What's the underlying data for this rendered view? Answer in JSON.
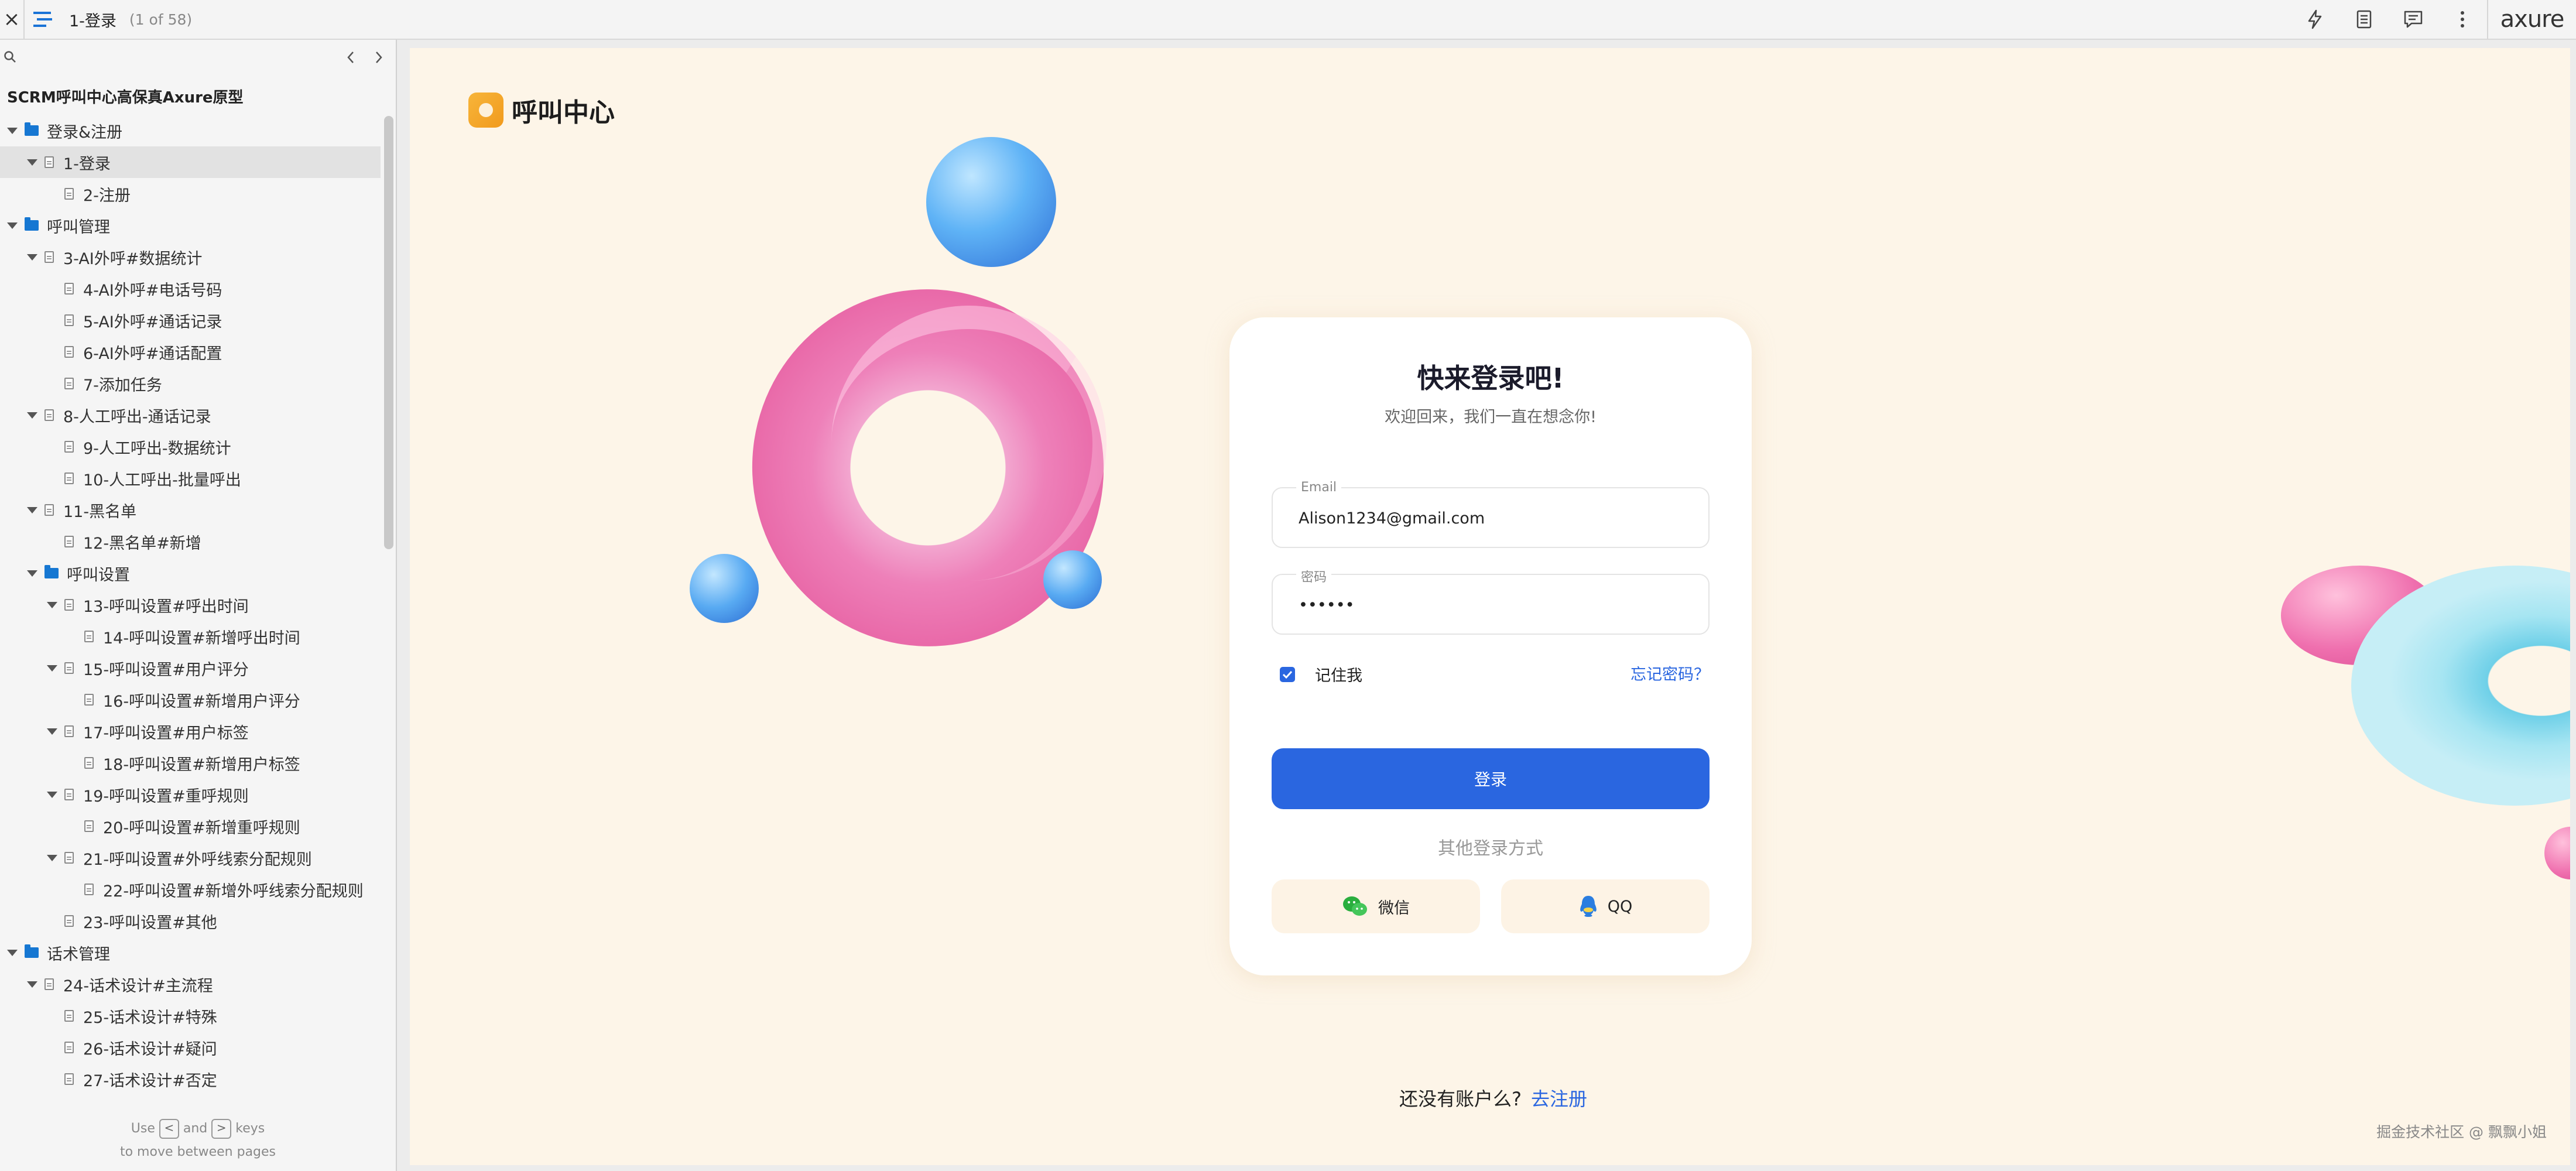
{
  "topbar": {
    "page_title": "1-登录",
    "page_count": "(1 of 58)",
    "brand": "axure"
  },
  "sidebar": {
    "search_placeholder": "",
    "project_title": "SCRM呼叫中心高保真Axure原型",
    "tree": [
      {
        "label": "登录&注册",
        "type": "folder",
        "level": 0,
        "expanded": true
      },
      {
        "label": "1-登录",
        "type": "page",
        "level": 1,
        "expanded": true,
        "selected": true
      },
      {
        "label": "2-注册",
        "type": "page",
        "level": 2
      },
      {
        "label": "呼叫管理",
        "type": "folder",
        "level": 0,
        "expanded": true
      },
      {
        "label": "3-AI外呼#数据统计",
        "type": "page",
        "level": 1,
        "expanded": true
      },
      {
        "label": "4-AI外呼#电话号码",
        "type": "page",
        "level": 2
      },
      {
        "label": "5-AI外呼#通话记录",
        "type": "page",
        "level": 2
      },
      {
        "label": "6-AI外呼#通话配置",
        "type": "page",
        "level": 2
      },
      {
        "label": "7-添加任务",
        "type": "page",
        "level": 2
      },
      {
        "label": "8-人工呼出-通话记录",
        "type": "page",
        "level": 1,
        "expanded": true
      },
      {
        "label": "9-人工呼出-数据统计",
        "type": "page",
        "level": 2
      },
      {
        "label": "10-人工呼出-批量呼出",
        "type": "page",
        "level": 2
      },
      {
        "label": "11-黑名单",
        "type": "page",
        "level": 1,
        "expanded": true
      },
      {
        "label": "12-黑名单#新增",
        "type": "page",
        "level": 2
      },
      {
        "label": "呼叫设置",
        "type": "folder",
        "level": 1,
        "expanded": true
      },
      {
        "label": "13-呼叫设置#呼出时间",
        "type": "page",
        "level": 2,
        "expanded": true
      },
      {
        "label": "14-呼叫设置#新增呼出时间",
        "type": "page",
        "level": 3
      },
      {
        "label": "15-呼叫设置#用户评分",
        "type": "page",
        "level": 2,
        "expanded": true
      },
      {
        "label": "16-呼叫设置#新增用户评分",
        "type": "page",
        "level": 3
      },
      {
        "label": "17-呼叫设置#用户标签",
        "type": "page",
        "level": 2,
        "expanded": true
      },
      {
        "label": "18-呼叫设置#新增用户标签",
        "type": "page",
        "level": 3
      },
      {
        "label": "19-呼叫设置#重呼规则",
        "type": "page",
        "level": 2,
        "expanded": true
      },
      {
        "label": "20-呼叫设置#新增重呼规则",
        "type": "page",
        "level": 3
      },
      {
        "label": "21-呼叫设置#外呼线索分配规则",
        "type": "page",
        "level": 2,
        "expanded": true
      },
      {
        "label": "22-呼叫设置#新增外呼线索分配规则",
        "type": "page",
        "level": 3
      },
      {
        "label": "23-呼叫设置#其他",
        "type": "page",
        "level": 2
      },
      {
        "label": "话术管理",
        "type": "folder",
        "level": 0,
        "expanded": true
      },
      {
        "label": "24-话术设计#主流程",
        "type": "page",
        "level": 1,
        "expanded": true
      },
      {
        "label": "25-话术设计#特殊",
        "type": "page",
        "level": 2
      },
      {
        "label": "26-话术设计#疑问",
        "type": "page",
        "level": 2
      },
      {
        "label": "27-话术设计#否定",
        "type": "page",
        "level": 2
      }
    ],
    "hint": {
      "use": "Use",
      "key_prev": "<",
      "and": "and",
      "key_next": ">",
      "keys": "keys",
      "line2": "to move between pages"
    }
  },
  "page": {
    "brand_name": "呼叫中心",
    "login": {
      "title": "快来登录吧!",
      "subtitle": "欢迎回来，我们一直在想念你!",
      "email_label": "Email",
      "email_value": "Alison1234@gmail.com",
      "password_label": "密码",
      "password_value": "123456",
      "remember_label": "记住我",
      "remember_checked": true,
      "forgot_label": "忘记密码？",
      "submit_label": "登录",
      "other_methods": "其他登录方式",
      "wechat_label": "微信",
      "qq_label": "QQ"
    },
    "signup_prompt": "还没有账户么?",
    "signup_link": "去注册",
    "watermark": "掘金技术社区 @ 飘飘小姐"
  },
  "colors": {
    "accent": "#2a66e0",
    "canvas_bg": "#fdf5e8",
    "brand_orange": "#f4a62a",
    "folder_blue": "#1677d2"
  }
}
